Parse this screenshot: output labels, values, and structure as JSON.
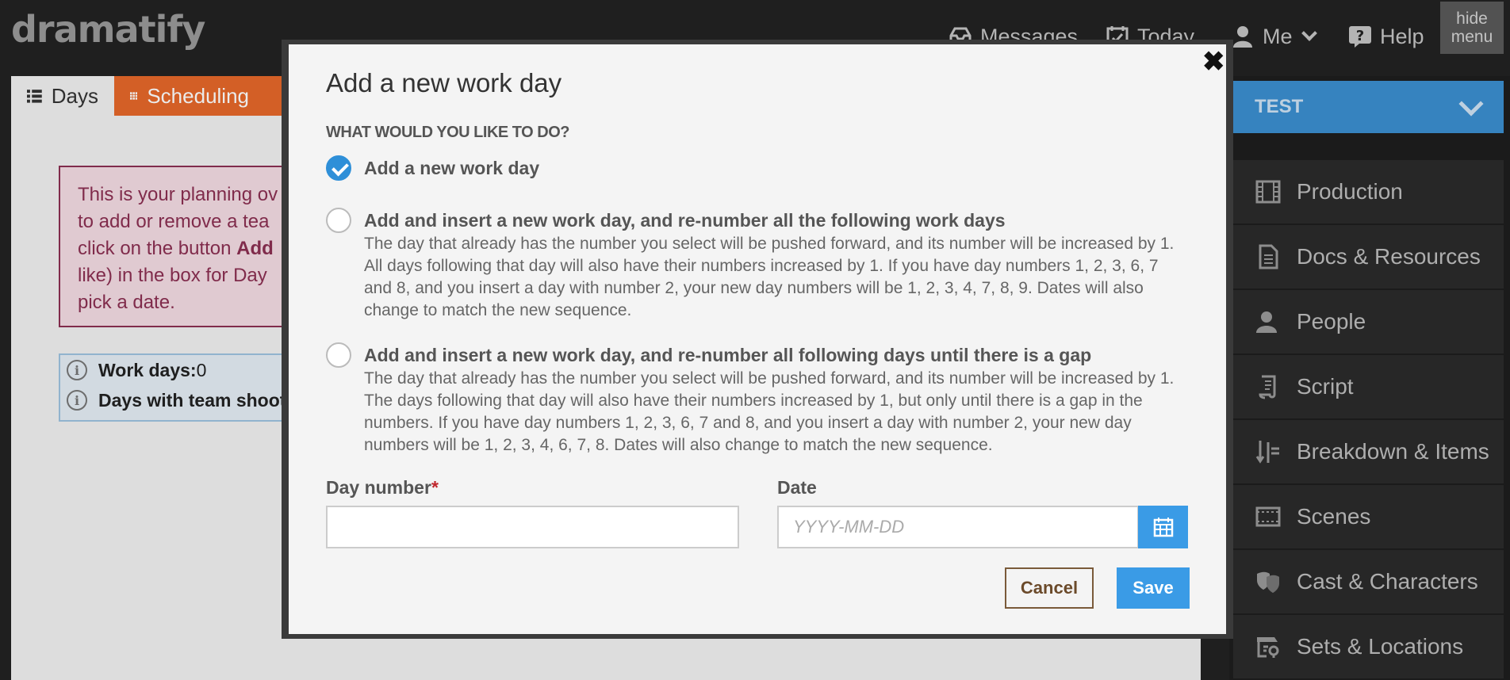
{
  "app": {
    "logo": "dramatify"
  },
  "topnav": {
    "messages": "Messages",
    "today": "Today",
    "me": "Me",
    "help": "Help",
    "hide_menu_line1": "hide",
    "hide_menu_line2": "menu"
  },
  "tabs": {
    "days": "Days",
    "scheduling": "Scheduling"
  },
  "planning": {
    "line1": "This is your planning ov",
    "line2": "to add or remove a tea",
    "line3_pre": "click on the button ",
    "line3_bold": "Add",
    "line4": "like) in the box for Day",
    "line5": "pick a date."
  },
  "info": {
    "work_days_label": "Work days:",
    "work_days_value": " 0",
    "team_shoot_label": "Days with team shoot"
  },
  "sidebar": {
    "project": "TEST",
    "items": [
      {
        "label": "Production",
        "icon": "film-icon"
      },
      {
        "label": "Docs & Resources",
        "icon": "document-icon"
      },
      {
        "label": "People",
        "icon": "people-icon"
      },
      {
        "label": "Script",
        "icon": "script-icon"
      },
      {
        "label": "Breakdown & Items",
        "icon": "breakdown-icon"
      },
      {
        "label": "Scenes",
        "icon": "scenes-icon"
      },
      {
        "label": "Cast & Characters",
        "icon": "masks-icon"
      },
      {
        "label": "Sets & Locations",
        "icon": "location-icon"
      }
    ]
  },
  "modal": {
    "title": "Add a new work day",
    "question": "WHAT WOULD YOU LIKE TO DO?",
    "options": [
      {
        "label": "Add a new work day",
        "desc": "",
        "checked": true
      },
      {
        "label": "Add and insert a new work day, and re-number all the following work days",
        "desc": "The day that already has the number you select will be pushed forward, and its number will be increased by 1. All days following that day will also have their numbers increased by 1. If you have day numbers 1, 2, 3, 6, 7 and 8, and you insert a day with number 2, your new day numbers will be 1, 2, 3, 4, 7, 8, 9. Dates will also change to match the new sequence.",
        "checked": false
      },
      {
        "label": "Add and insert a new work day, and re-number all following days until there is a gap",
        "desc": "The day that already has the number you select will be pushed forward, and its number will be increased by 1. The days following that day will also have their numbers increased by 1, but only until there is a gap in the numbers. If you have day numbers 1, 2, 3, 6, 7 and 8, and you insert a day with number 2, your new day numbers will be 1, 2, 3, 4, 6, 7, 8. Dates will also change to match the new sequence.",
        "checked": false
      }
    ],
    "day_number_label": "Day number",
    "required_mark": "*",
    "day_number_value": "",
    "date_label": "Date",
    "date_placeholder": "YYYY-MM-DD",
    "cancel": "Cancel",
    "save": "Save"
  },
  "colors": {
    "accent": "#3a9be6",
    "orange": "#e5682a",
    "plum": "#8b2f52"
  }
}
